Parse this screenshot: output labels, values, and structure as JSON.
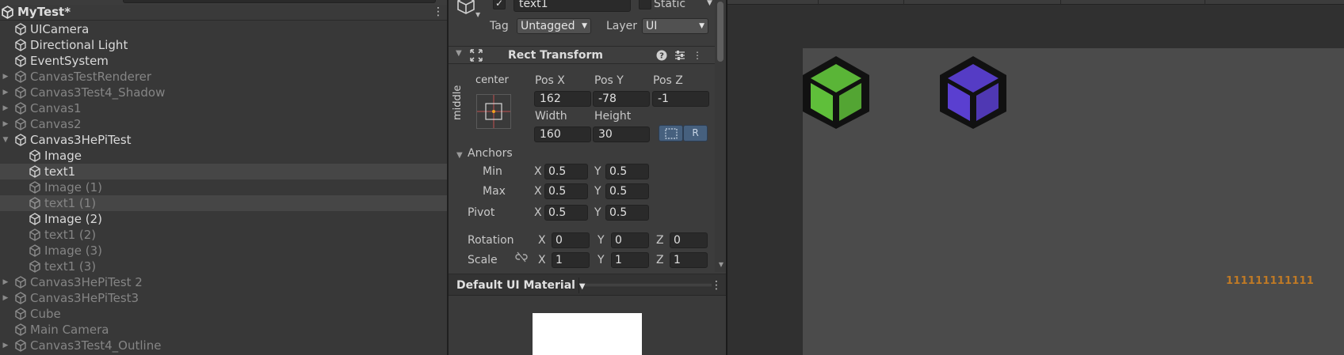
{
  "hierarchy": {
    "scene_title": "MyTest*",
    "items": [
      {
        "label": "UICamera",
        "indent": 0,
        "fold": "",
        "active": true,
        "selected": false
      },
      {
        "label": "Directional Light",
        "indent": 0,
        "fold": "",
        "active": true,
        "selected": false
      },
      {
        "label": "EventSystem",
        "indent": 0,
        "fold": "",
        "active": true,
        "selected": false
      },
      {
        "label": "CanvasTestRenderer",
        "indent": 0,
        "fold": "▶",
        "active": false,
        "selected": false
      },
      {
        "label": "Canvas3Test4_Shadow",
        "indent": 0,
        "fold": "▶",
        "active": false,
        "selected": false
      },
      {
        "label": "Canvas1",
        "indent": 0,
        "fold": "▶",
        "active": false,
        "selected": false
      },
      {
        "label": "Canvas2",
        "indent": 0,
        "fold": "▶",
        "active": false,
        "selected": false
      },
      {
        "label": "Canvas3HePiTest",
        "indent": 0,
        "fold": "▼",
        "active": true,
        "selected": false
      },
      {
        "label": "Image",
        "indent": 1,
        "fold": "",
        "active": true,
        "selected": false
      },
      {
        "label": "text1",
        "indent": 1,
        "fold": "",
        "active": true,
        "selected": true
      },
      {
        "label": "Image (1)",
        "indent": 1,
        "fold": "",
        "active": false,
        "selected": false
      },
      {
        "label": "text1 (1)",
        "indent": 1,
        "fold": "",
        "active": false,
        "selected": true
      },
      {
        "label": "Image (2)",
        "indent": 1,
        "fold": "",
        "active": true,
        "selected": false
      },
      {
        "label": "text1 (2)",
        "indent": 1,
        "fold": "",
        "active": false,
        "selected": false
      },
      {
        "label": "Image (3)",
        "indent": 1,
        "fold": "",
        "active": false,
        "selected": false
      },
      {
        "label": "text1 (3)",
        "indent": 1,
        "fold": "",
        "active": false,
        "selected": false
      },
      {
        "label": "Canvas3HePiTest 2",
        "indent": 0,
        "fold": "▶",
        "active": false,
        "selected": false
      },
      {
        "label": "Canvas3HePiTest3",
        "indent": 0,
        "fold": "▶",
        "active": false,
        "selected": false
      },
      {
        "label": "Cube",
        "indent": 0,
        "fold": "",
        "active": false,
        "selected": false
      },
      {
        "label": "Main Camera",
        "indent": 0,
        "fold": "",
        "active": false,
        "selected": false
      },
      {
        "label": "Canvas3Test4_Outline",
        "indent": 0,
        "fold": "▶",
        "active": false,
        "selected": false
      }
    ]
  },
  "inspector": {
    "object_name": "text1",
    "active_checked": "✓",
    "static_label": "Static",
    "tag_label": "Tag",
    "tag_value": "Untagged",
    "layer_label": "Layer",
    "layer_value": "UI",
    "component_title": "Rect Transform",
    "anchor_preset_h": "center",
    "anchor_preset_v": "middle",
    "pos_x_label": "Pos X",
    "pos_y_label": "Pos Y",
    "pos_z_label": "Pos Z",
    "pos_x": "162",
    "pos_y": "-78",
    "pos_z": "-1",
    "width_label": "Width",
    "height_label": "Height",
    "width": "160",
    "height": "30",
    "raw_edit_label": "R",
    "anchors_label": "Anchors",
    "min_label": "Min",
    "max_label": "Max",
    "pivot_label": "Pivot",
    "x_label": "X",
    "y_label": "Y",
    "z_label": "Z",
    "anchor_min_x": "0.5",
    "anchor_min_y": "0.5",
    "anchor_max_x": "0.5",
    "anchor_max_y": "0.5",
    "pivot_x": "0.5",
    "pivot_y": "0.5",
    "rotation_label": "Rotation",
    "rotation_x": "0",
    "rotation_y": "0",
    "rotation_z": "0",
    "scale_label": "Scale",
    "scale_x": "1",
    "scale_y": "1",
    "scale_z": "1",
    "material_name": "Default UI Material"
  },
  "game_view": {
    "text": "111111111111",
    "text_color": "#c07a25",
    "logo_left_color": "#5fbf3a",
    "logo_right_color": "#5a3fd0"
  }
}
